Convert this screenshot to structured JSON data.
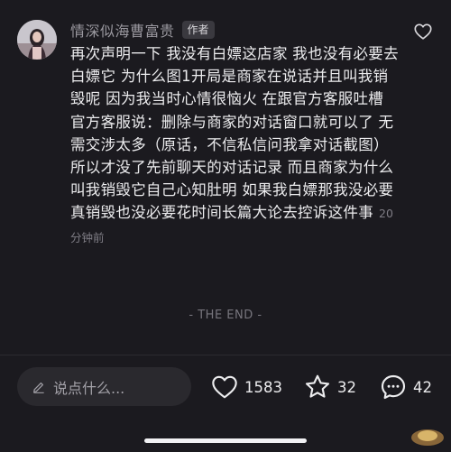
{
  "comment": {
    "author": "情深似海曹富贵",
    "author_tag": "作者",
    "text": "再次声明一下 我没有白嫖这店家 我也没有必要去白嫖它 为什么图1开局是商家在说话并且叫我销毁呢 因为我当时心情很恼火 在跟官方客服吐槽 官方客服说：删除与商家的对话窗口就可以了 无需交涉太多（原话，不信私信问我拿对话截图）所以才没了先前聊天的对话记录 而且商家为什么叫我销毁它自己心知肚明 如果我白嫖那我没必要真销毁也没必要花时间长篇大论去控诉这件事",
    "time": "20 分钟前"
  },
  "end_marker": "- THE END -",
  "bottom_bar": {
    "input_placeholder": "说点什么...",
    "likes": "1583",
    "stars": "32",
    "comments": "42"
  },
  "colors": {
    "background": "#1b1a1f",
    "input_bg": "#2a292e",
    "muted_text": "#9a989f",
    "primary_text": "#ececee"
  },
  "icons": {
    "top_like": "heart-outline-icon",
    "like": "heart-outline-icon",
    "collect": "star-outline-icon",
    "comment": "chat-bubble-icon",
    "edit": "pencil-icon"
  }
}
